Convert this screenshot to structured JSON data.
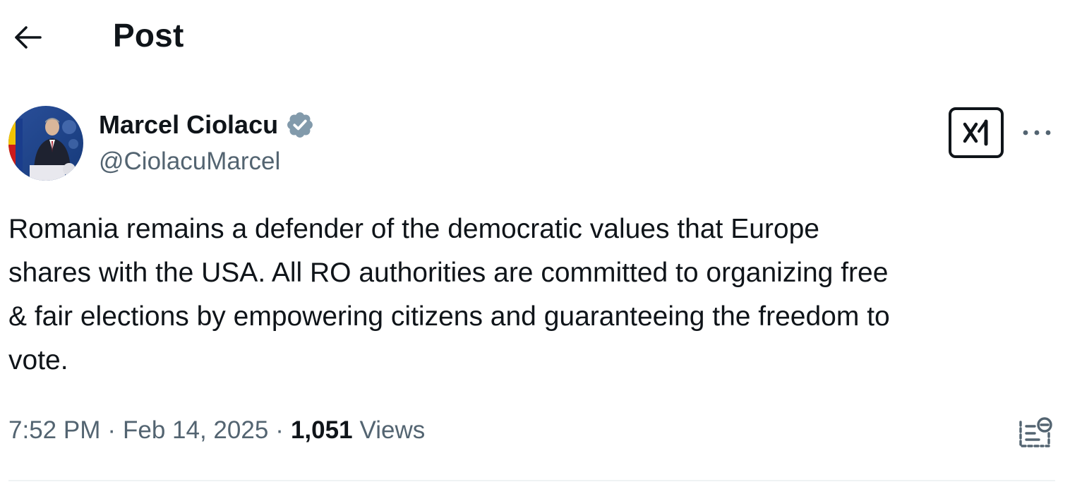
{
  "header": {
    "title": "Post",
    "back_icon": "arrow-left-icon"
  },
  "author": {
    "name": "Marcel Ciolacu",
    "handle": "@CiolacuMarcel",
    "verified_icon": "verified-badge-icon",
    "verified_color": "#829aab"
  },
  "actions": {
    "grok_icon": "grok-icon",
    "more_icon": "more-horizontal-icon",
    "analytics_icon": "analytics-icon"
  },
  "post": {
    "text": "Romania remains a defender of the democratic values that Europe\nshares with the USA. All RO authorities are committed to organizing free\n& fair elections by empowering citizens and guaranteeing the freedom to\nvote.",
    "time": "7:52 PM",
    "separator": "·",
    "date": "Feb 14, 2025",
    "views_count": "1,051",
    "views_label": "Views"
  },
  "colors": {
    "text_primary": "#0f1419",
    "text_secondary": "#536471",
    "divider": "#eff3f4"
  }
}
